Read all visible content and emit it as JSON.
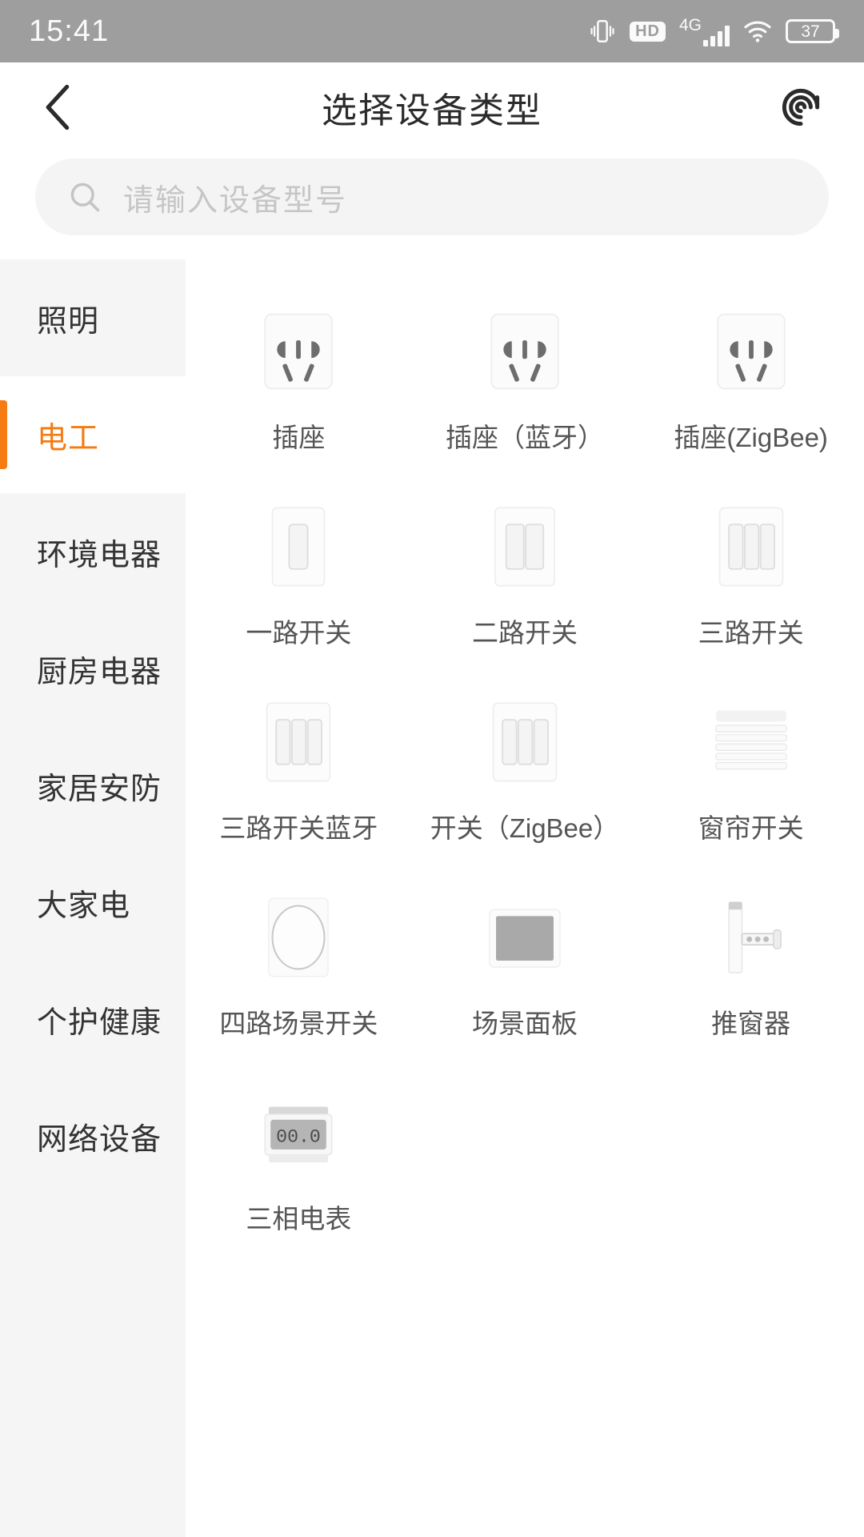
{
  "status_bar": {
    "time": "15:41",
    "icons": [
      "vibrate-icon",
      "hd-icon",
      "4g-icon",
      "wifi-icon",
      "battery-icon"
    ],
    "network_label": "4G",
    "hd_label": "HD",
    "battery_level": "37"
  },
  "nav": {
    "title": "选择设备类型",
    "back_icon": "chevron-left-icon",
    "scan_icon": "scan-spiral-icon"
  },
  "search": {
    "placeholder": "请输入设备型号",
    "value": "",
    "icon": "search-icon"
  },
  "sidebar": {
    "active_index": 1,
    "items": [
      {
        "label": "照明"
      },
      {
        "label": "电工"
      },
      {
        "label": "环境电器"
      },
      {
        "label": "厨房电器"
      },
      {
        "label": "家居安防"
      },
      {
        "label": "大家电"
      },
      {
        "label": "个护健康"
      },
      {
        "label": "网络设备"
      }
    ]
  },
  "devices": [
    {
      "label": "插座",
      "icon": "socket-icon"
    },
    {
      "label": "插座（蓝牙）",
      "icon": "socket-icon"
    },
    {
      "label": "插座(ZigBee)",
      "icon": "socket-icon"
    },
    {
      "label": "一路开关",
      "icon": "switch-1gang-icon"
    },
    {
      "label": "二路开关",
      "icon": "switch-2gang-icon"
    },
    {
      "label": "三路开关",
      "icon": "switch-3gang-icon"
    },
    {
      "label": "三路开关蓝牙",
      "icon": "switch-3gang-icon"
    },
    {
      "label": "开关（ZigBee）",
      "icon": "switch-3gang-icon"
    },
    {
      "label": "窗帘开关",
      "icon": "curtain-blind-icon"
    },
    {
      "label": "四路场景开关",
      "icon": "round-knob-panel-icon"
    },
    {
      "label": "场景面板",
      "icon": "scene-screen-panel-icon"
    },
    {
      "label": "推窗器",
      "icon": "window-opener-icon"
    },
    {
      "label": "三相电表",
      "icon": "power-meter-icon",
      "display_value": "00.0"
    }
  ],
  "colors": {
    "accent": "#f57b12",
    "status_bar_bg": "#9e9e9e",
    "sidebar_bg": "#f5f5f5",
    "search_bg": "#f4f4f4",
    "text_primary": "#333333",
    "text_caption": "#555555",
    "placeholder": "#c6c6c6"
  }
}
